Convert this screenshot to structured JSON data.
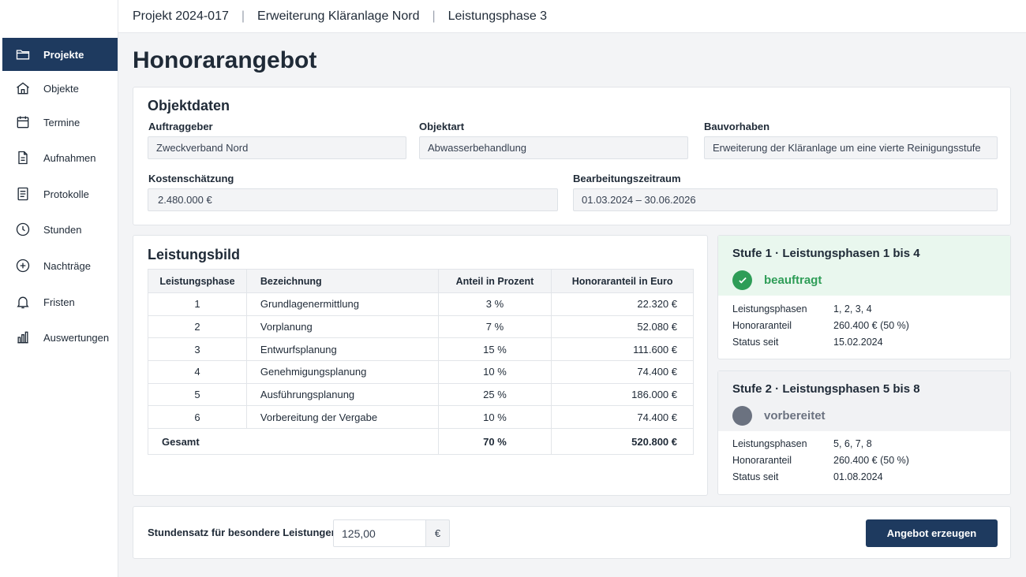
{
  "breadcrumb": {
    "project": "Projekt 2024-017",
    "object": "Erweiterung Kläranlage Nord",
    "phase": "Leistungsphase 3"
  },
  "sidebar": {
    "items": [
      {
        "label": "Projekte",
        "icon": "folder-icon",
        "active": true
      },
      {
        "label": "Objekte",
        "icon": "home-icon"
      },
      {
        "label": "Termine",
        "icon": "calendar-icon"
      },
      {
        "label": "Aufnahmen",
        "icon": "document-icon"
      },
      {
        "label": "Protokolle",
        "icon": "list-document-icon"
      },
      {
        "label": "Stunden",
        "icon": "clock-icon"
      },
      {
        "label": "Nachträge",
        "icon": "plus-circle-icon"
      },
      {
        "label": "Fristen",
        "icon": "bell-icon"
      },
      {
        "label": "Auswertungen",
        "icon": "bar-chart-icon"
      }
    ]
  },
  "page": {
    "title": "Honorarangebot"
  },
  "objektdaten": {
    "title": "Objektdaten",
    "auftraggeber": {
      "label": "Auftraggeber",
      "value": "Zweckverband Nord"
    },
    "objektart": {
      "label": "Objektart",
      "value": "Abwasserbehandlung"
    },
    "bauvorhaben": {
      "label": "Bauvorhaben",
      "value": "Erweiterung der Kläranlage um eine vierte Reinigungsstufe"
    },
    "kosten": {
      "label": "Kostenschätzung",
      "value": "2.480.000 €"
    },
    "zeitraum": {
      "label": "Bearbeitungszeitraum",
      "value": "01.03.2024 – 30.06.2026"
    }
  },
  "leistungsbild": {
    "title": "Leistungsbild",
    "headers": [
      "Leistungsphase",
      "Bezeichnung",
      "Anteil in Prozent",
      "Honoraranteil in Euro"
    ],
    "rows": [
      [
        "1",
        "Grundlagenermittlung",
        "3 %",
        "22.320 €"
      ],
      [
        "2",
        "Vorplanung",
        "7 %",
        "52.080 €"
      ],
      [
        "3",
        "Entwurfsplanung",
        "15 %",
        "111.600 €"
      ],
      [
        "4",
        "Genehmigungsplanung",
        "10 %",
        "74.400 €"
      ],
      [
        "5",
        "Ausführungsplanung",
        "25 %",
        "186.000 €"
      ],
      [
        "6",
        "Vorbereitung der Vergabe",
        "10 %",
        "74.400 €"
      ]
    ],
    "total": {
      "label": "Gesamt",
      "percent": "70 %",
      "amount": "520.800 €"
    }
  },
  "stages": [
    {
      "title": "Stufe 1 · Leistungsphasen 1 bis 4",
      "status": "beauftragt",
      "status_color": "#2e9d57",
      "rows": [
        {
          "label": "Leistungsphasen",
          "value": "1, 2, 3, 4"
        },
        {
          "label": "Honoraranteil",
          "value": "260.400 € (50 %)"
        },
        {
          "label": "Status seit",
          "value": "15.02.2024"
        }
      ]
    },
    {
      "title": "Stufe 2 · Leistungsphasen 5 bis 8",
      "status": "vorbereitet",
      "status_color": "#6b7280",
      "rows": [
        {
          "label": "Leistungsphasen",
          "value": "5, 6, 7, 8"
        },
        {
          "label": "Honoraranteil",
          "value": "260.400 € (50 %)"
        },
        {
          "label": "Status seit",
          "value": "01.08.2024"
        }
      ]
    }
  ],
  "footer": {
    "rate_label": "Stundensatz für besondere Leistungen",
    "rate_value": "125,00",
    "currency": "€",
    "button_label": "Angebot erzeugen"
  },
  "colors": {
    "primary": "#1e3a5f",
    "success": "#2e9d57",
    "success_bg": "#e9f7ee",
    "neutral": "#6b7280"
  }
}
